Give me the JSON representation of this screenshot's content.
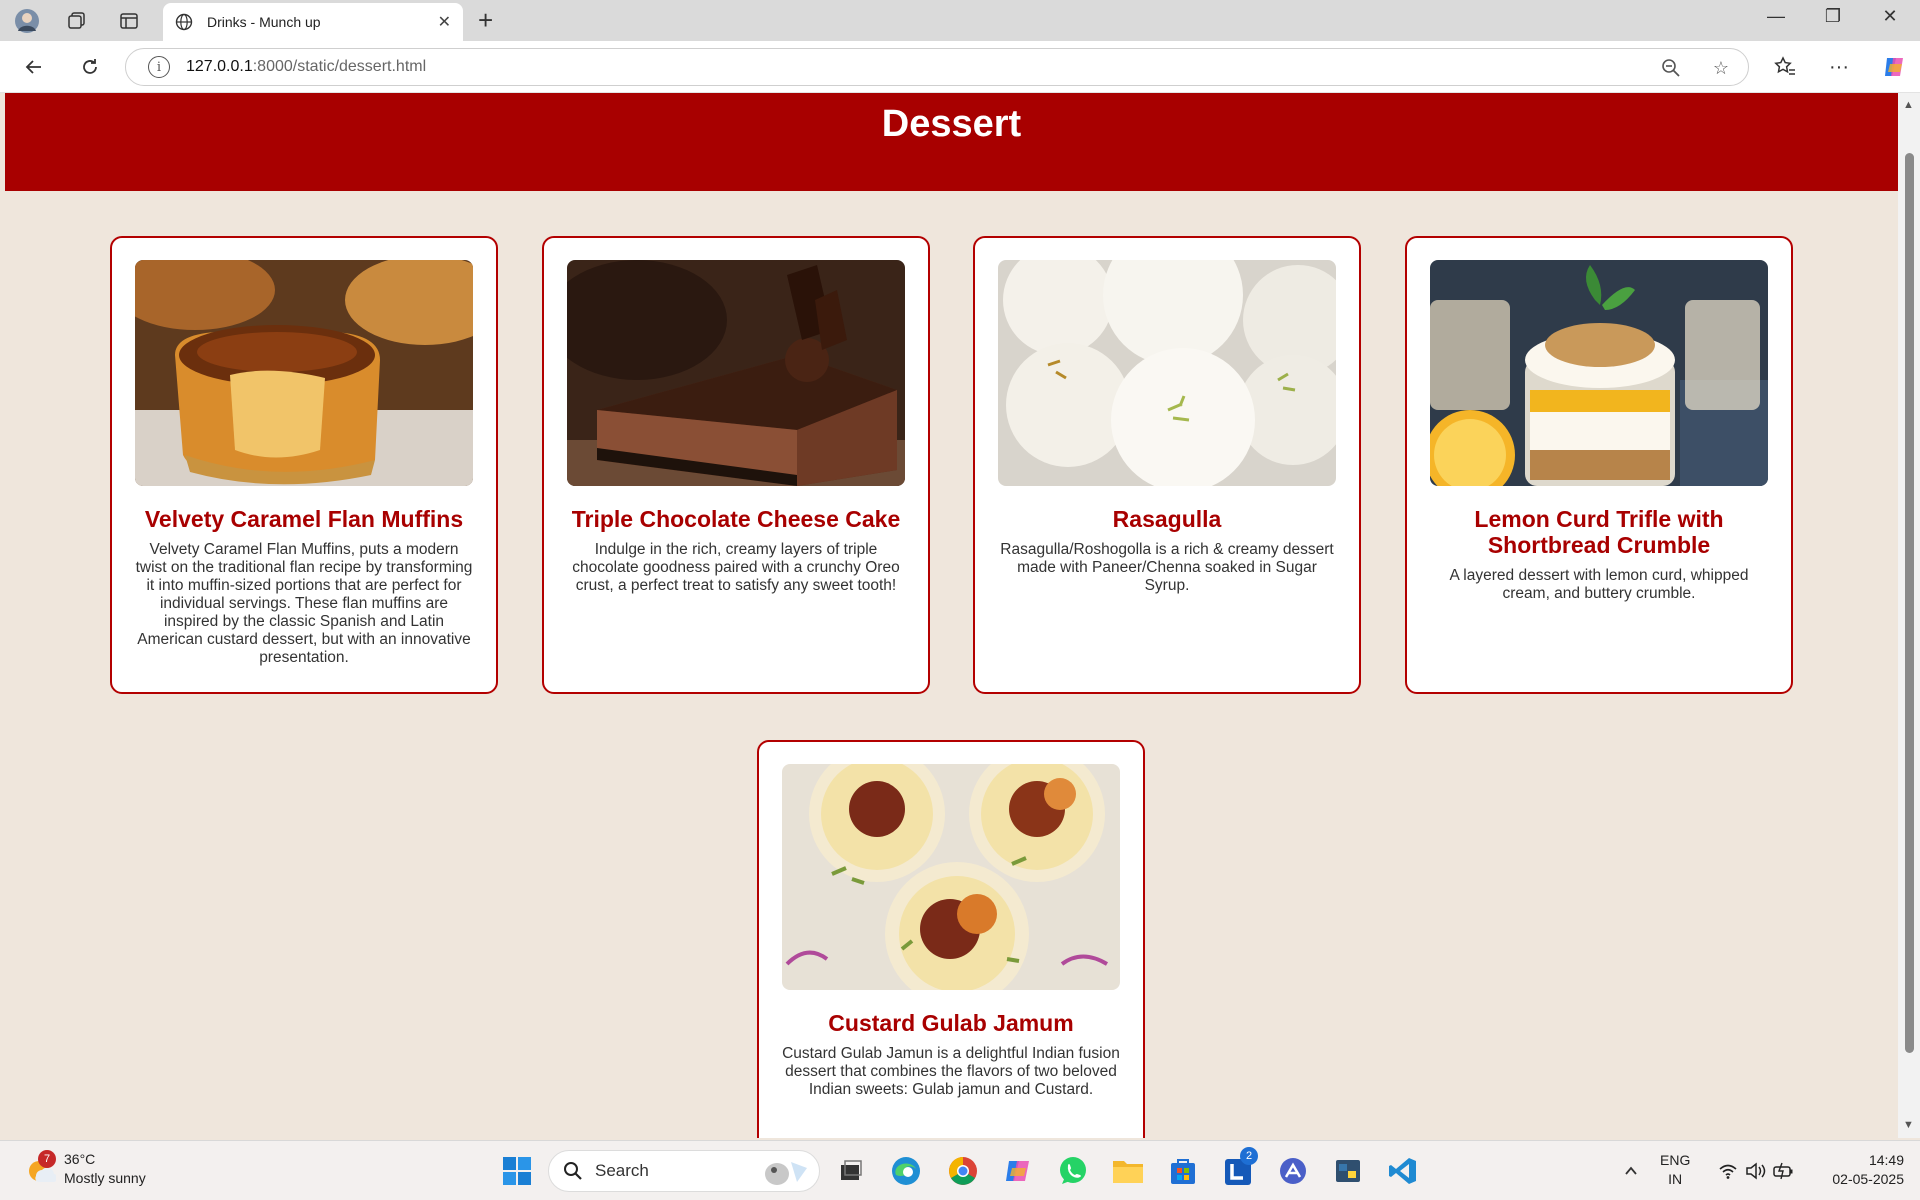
{
  "browser": {
    "tab_title": "Drinks - Munch up",
    "url_host": "127.0.0.1",
    "url_rest": ":8000/static/dessert.html"
  },
  "page": {
    "title": "Dessert",
    "cards": [
      {
        "title": "Velvety Caramel Flan Muffins",
        "description": "Velvety Caramel Flan Muffins, puts a modern twist on the traditional flan recipe by transforming it into muffin-sized portions that are perfect for individual servings. These flan muffins are inspired by the classic Spanish and Latin American custard dessert, but with an innovative presentation."
      },
      {
        "title": "Triple Chocolate Cheese Cake",
        "description": "Indulge in the rich, creamy layers of triple chocolate goodness paired with a crunchy Oreo crust, a perfect treat to satisfy any sweet tooth!"
      },
      {
        "title": "Rasagulla",
        "description": "Rasagulla/Roshogolla is a rich & creamy dessert made with Paneer/Chenna soaked in Sugar Syrup."
      },
      {
        "title": "Lemon Curd Trifle with Shortbread Crumble",
        "description": "A layered dessert with lemon curd, whipped cream, and buttery crumble."
      },
      {
        "title": "Custard Gulab Jamum",
        "description": "Custard Gulab Jamun is a delightful Indian fusion dessert that combines the flavors of two beloved Indian sweets: Gulab jamun and Custard."
      }
    ]
  },
  "taskbar": {
    "weather_badge": "7",
    "temperature": "36°C",
    "condition": "Mostly sunny",
    "search_label": "Search",
    "store_badge": "2",
    "lang_1": "ENG",
    "lang_2": "IN",
    "time": "14:49",
    "date": "02-05-2025"
  },
  "colors": {
    "accent": "#a80000",
    "page_background": "#efe6dc",
    "card_border": "#b30000"
  }
}
